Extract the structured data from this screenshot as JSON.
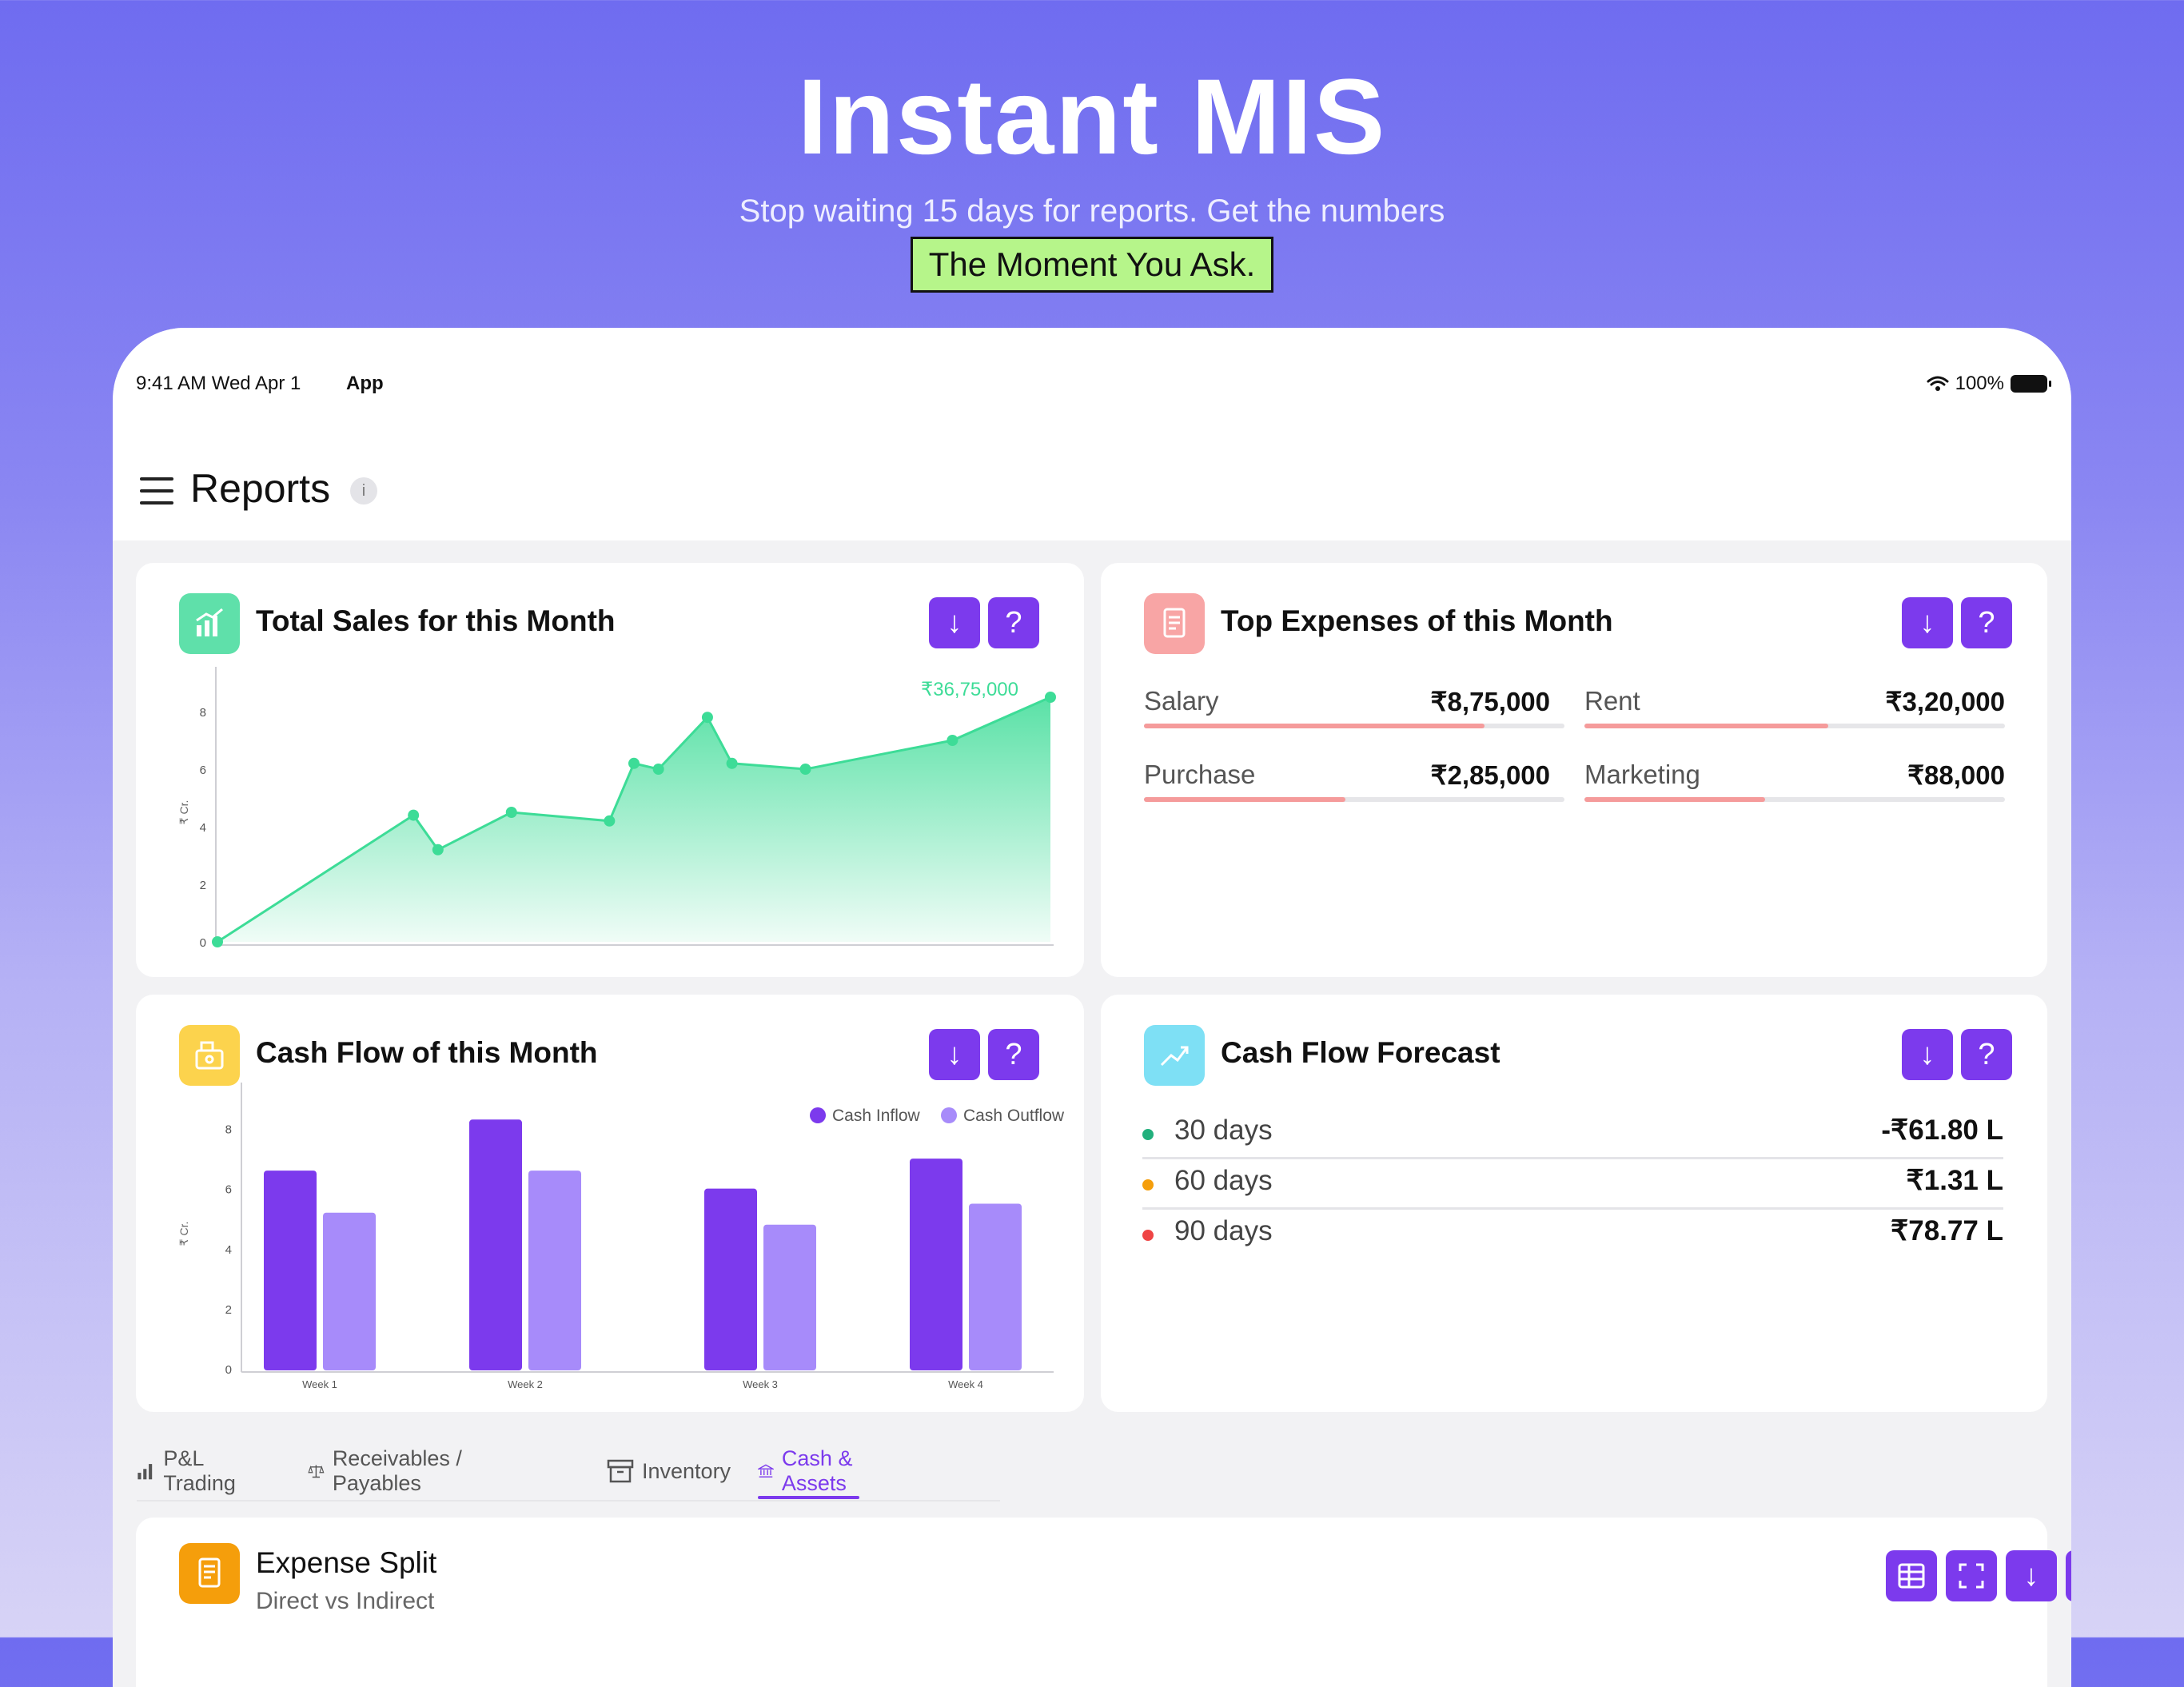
{
  "hero": {
    "title": "Instant MIS",
    "subtitle": "Stop waiting 15 days for reports. Get the numbers",
    "highlight": "The Moment You Ask."
  },
  "status": {
    "time": "9:41 AM  Wed Apr 1",
    "app": "App",
    "battery": "100%"
  },
  "header": {
    "title": "Reports",
    "info_icon": "i"
  },
  "cards": {
    "sales": {
      "title": "Total Sales for this Month",
      "icon": "bar-chart-icon",
      "download": "↓",
      "help": "?"
    },
    "expenses": {
      "title": "Top Expenses of this Month",
      "icon": "receipt-icon",
      "download": "↓",
      "help": "?",
      "items": [
        {
          "label": "Salary",
          "value": "₹8,75,000",
          "fraction": 0.81
        },
        {
          "label": "Rent",
          "value": "₹3,20,000",
          "fraction": 0.58
        },
        {
          "label": "Purchase",
          "value": "₹2,85,000",
          "fraction": 0.48
        },
        {
          "label": "Marketing",
          "value": "₹88,000",
          "fraction": 0.43
        }
      ]
    },
    "cashflow": {
      "title": "Cash Flow of this Month",
      "icon": "cash-register-icon",
      "download": "↓",
      "help": "?"
    },
    "forecast": {
      "title": "Cash Flow Forecast",
      "icon": "trend-up-icon",
      "download": "↓",
      "help": "?",
      "rows": [
        {
          "label": "30 days",
          "value": "-₹61.80 L",
          "color": "#22b07d"
        },
        {
          "label": "60 days",
          "value": "₹1.31 L",
          "color": "#f59e0b"
        },
        {
          "label": "90 days",
          "value": "₹78.77 L",
          "color": "#ef4444"
        }
      ]
    },
    "expense_split": {
      "title": "Expense Split",
      "subtitle": "Direct vs Indirect",
      "icon": "document-icon"
    }
  },
  "tabs": [
    {
      "label": "P&L Trading",
      "icon": "bar-chart-icon",
      "active": false
    },
    {
      "label": "Receivables / Payables",
      "icon": "scale-icon",
      "active": false
    },
    {
      "label": "Inventory",
      "icon": "archive-icon",
      "active": false
    },
    {
      "label": "Cash & Assets",
      "icon": "bank-icon",
      "active": true
    }
  ],
  "colors": {
    "accent": "#7c3aed",
    "sales_line": "#3ddc97",
    "inflow": "#7c3aed",
    "outflow": "#a78bfa"
  },
  "chart_data": [
    {
      "type": "area",
      "ylabel": "₹ Cr.",
      "ylim": [
        0,
        9
      ],
      "yticks": [
        0,
        2,
        4,
        6,
        8
      ],
      "annotation": "₹36,75,000",
      "x": [
        1,
        5,
        5.5,
        7,
        9,
        9.5,
        10,
        11,
        11.5,
        13,
        16,
        18
      ],
      "y": [
        0,
        4.4,
        3.2,
        4.5,
        4.2,
        6.2,
        6.0,
        7.8,
        6.2,
        6.0,
        7.0,
        8.5
      ]
    },
    {
      "type": "bar",
      "ylabel": "₹ Cr.",
      "ylim": [
        0,
        9
      ],
      "yticks": [
        0,
        2,
        4,
        6,
        8
      ],
      "categories": [
        "Week 1",
        "Week 2",
        "Week 3",
        "Week 4"
      ],
      "legend_position": "top-right",
      "series": [
        {
          "name": "Cash Inflow",
          "values": [
            6.6,
            8.3,
            6.0,
            7.0
          ]
        },
        {
          "name": "Cash Outflow",
          "values": [
            5.2,
            6.6,
            4.8,
            5.5
          ]
        }
      ]
    }
  ]
}
